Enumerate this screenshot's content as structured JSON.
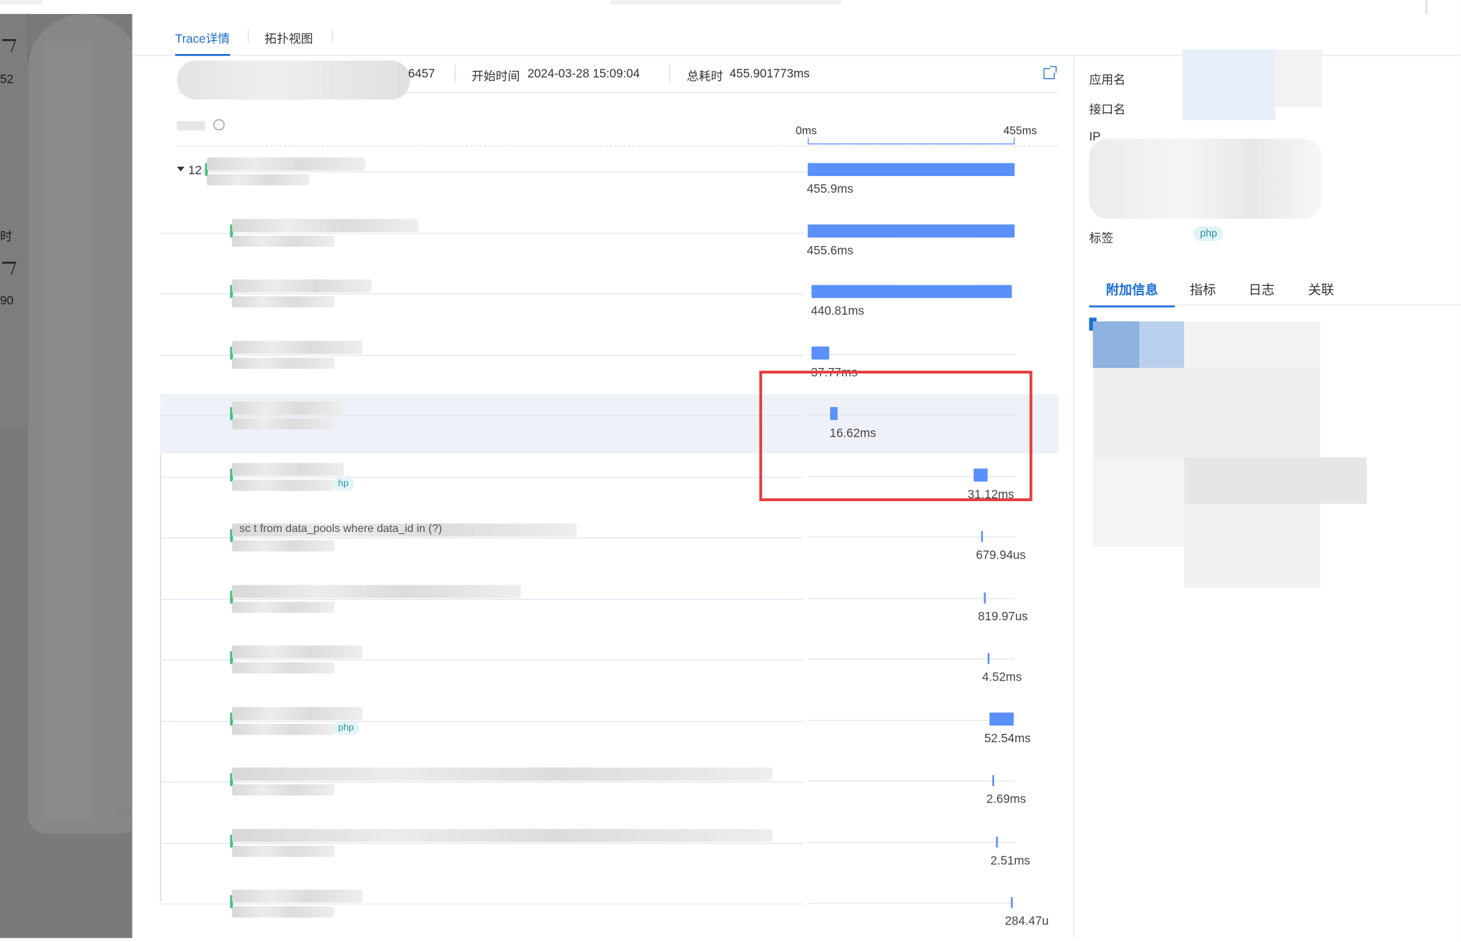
{
  "tabs": [
    "Trace详情",
    "拓扑视图"
  ],
  "info": {
    "trace_id_tail": "6457",
    "start_label": "开始时间",
    "start_value": "2024-03-28 15:09:04",
    "total_label": "总耗时",
    "total_value": "455.901773ms"
  },
  "tree": {
    "root_count": "12",
    "scale_start": "0ms",
    "scale_end": "455ms",
    "rows": [
      {
        "duration": "455.9ms",
        "duration_us": 455900,
        "start_fraction": 0.0,
        "name": "",
        "tag": ""
      },
      {
        "duration": "455.6ms",
        "duration_us": 455600,
        "start_fraction": 0.0,
        "name": "",
        "tag": ""
      },
      {
        "duration": "440.81ms",
        "duration_us": 440810,
        "start_fraction": 0.02,
        "name": "",
        "tag": ""
      },
      {
        "duration": "37.77ms",
        "duration_us": 37770,
        "start_fraction": 0.02,
        "name": "",
        "tag": ""
      },
      {
        "duration": "16.62ms",
        "duration_us": 16620,
        "start_fraction": 0.11,
        "name": "",
        "tag": ""
      },
      {
        "duration": "31.12ms",
        "duration_us": 31120,
        "start_fraction": 0.8,
        "name": "",
        "tag": "hp"
      },
      {
        "duration": "679.94us",
        "duration_us": 679.94,
        "start_fraction": 0.84,
        "name": "sc                    t  from    data_pools  where  data_id  in (?)",
        "tag": ""
      },
      {
        "duration": "819.97us",
        "duration_us": 819.97,
        "start_fraction": 0.85,
        "name": "",
        "tag": ""
      },
      {
        "duration": "4.52ms",
        "duration_us": 4520,
        "start_fraction": 0.87,
        "name": "",
        "tag": ""
      },
      {
        "duration": "52.54ms",
        "duration_us": 52540,
        "start_fraction": 0.88,
        "name": "",
        "tag": "php"
      },
      {
        "duration": "2.69ms",
        "duration_us": 2690,
        "start_fraction": 0.89,
        "name": "",
        "tag": ""
      },
      {
        "duration": "2.51ms",
        "duration_us": 2510,
        "start_fraction": 0.91,
        "name": "",
        "tag": ""
      },
      {
        "duration": "284.47u",
        "duration_us": 284.47,
        "start_fraction": 0.98,
        "name": "",
        "tag": ""
      }
    ]
  },
  "right_panel": {
    "labels": [
      "应用名",
      "接口名",
      "IP"
    ],
    "tags_label": "标签",
    "tag_value": "php",
    "sub_tabs": [
      "附加信息",
      "指标",
      "日志",
      "关联"
    ]
  },
  "background": {
    "left_texts": [
      "52",
      "时",
      "90",
      "a8"
    ]
  },
  "colors": {
    "accent": "#1d6fd6",
    "bar": "#5b8ff9",
    "highlight": "#e53e3e",
    "tag_bg": "#e3f4f6",
    "tag_text": "#2c8fa6"
  }
}
